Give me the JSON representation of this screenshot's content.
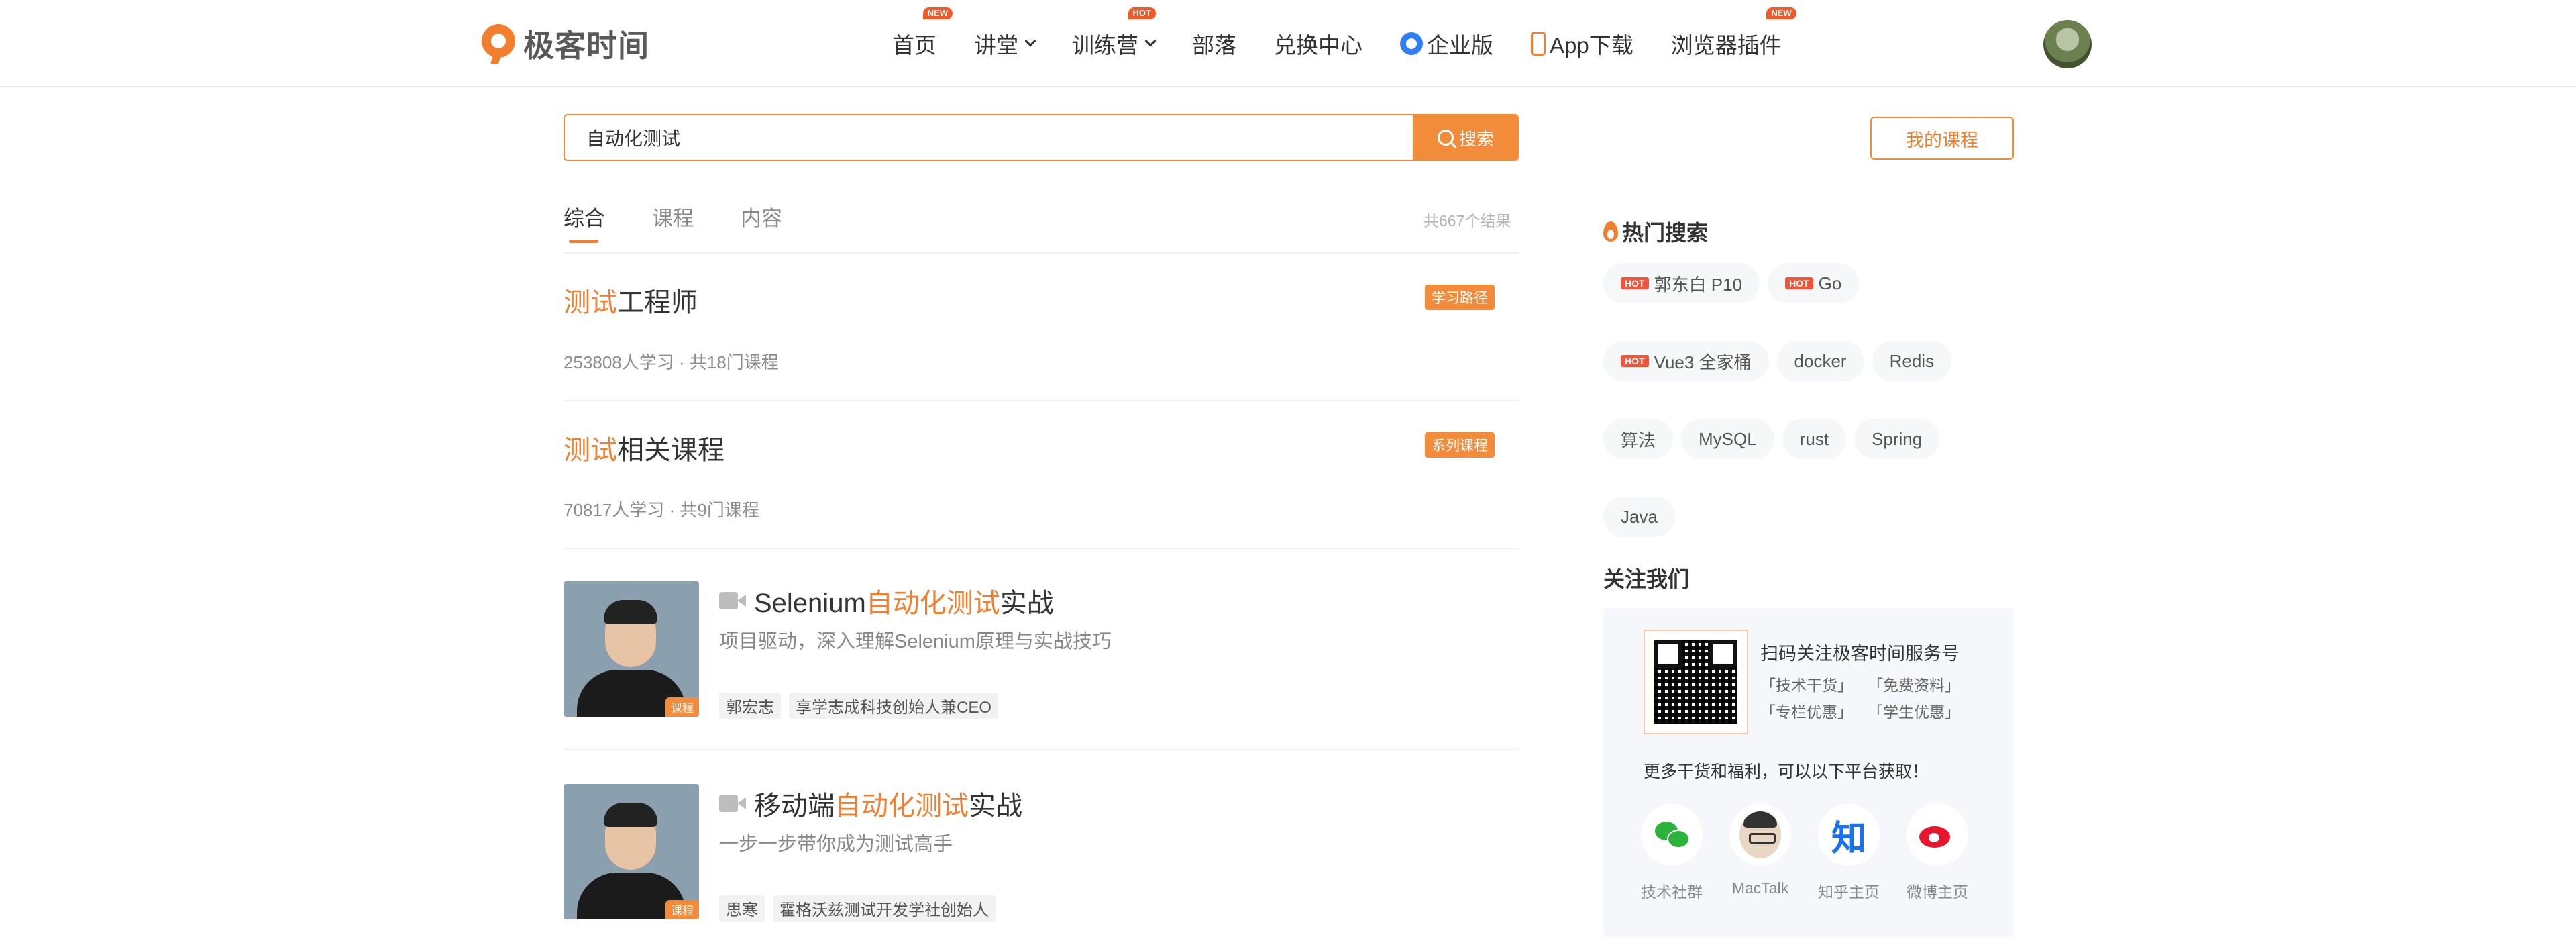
{
  "header": {
    "logo_text": "极客时间",
    "nav": [
      {
        "label": "首页",
        "badge": "NEW",
        "dropdown": false
      },
      {
        "label": "讲堂",
        "badge": "",
        "dropdown": true
      },
      {
        "label": "训练营",
        "badge": "HOT",
        "dropdown": true
      },
      {
        "label": "部落",
        "badge": "",
        "dropdown": false
      },
      {
        "label": "兑换中心",
        "badge": "",
        "dropdown": false
      },
      {
        "label": "企业版",
        "badge": "",
        "dropdown": false,
        "icon": "enterprise-icon"
      },
      {
        "label": "App下载",
        "badge": "",
        "dropdown": false,
        "icon": "phone-icon"
      },
      {
        "label": "浏览器插件",
        "badge": "NEW",
        "dropdown": false
      }
    ]
  },
  "search": {
    "value": "自动化测试",
    "button_label": "搜索",
    "my_courses_label": "我的课程"
  },
  "tabs": {
    "items": [
      "综合",
      "课程",
      "内容"
    ],
    "active": "综合",
    "result_count": "共667个结果"
  },
  "paths": [
    {
      "title_hl": "测试",
      "title_rest": "工程师",
      "meta": "253808人学习 · 共18门课程",
      "tag": "学习路径"
    },
    {
      "title_hl": "测试",
      "title_rest": "相关课程",
      "meta": "70817人学习 · 共9门课程",
      "tag": "系列课程"
    }
  ],
  "courses": [
    {
      "title_pre": "Selenium",
      "title_hl": "自动化测试",
      "title_post": "实战",
      "subtitle": "项目驱动，深入理解Selenium原理与实战技巧",
      "author": "郭宏志",
      "author_title": "享学志成科技创始人兼CEO",
      "thumb_tag": "课程"
    },
    {
      "title_pre": "移动端",
      "title_hl": "自动化测试",
      "title_post": "实战",
      "subtitle": "一步一步带你成为测试高手",
      "author": "思寒",
      "author_title": "霍格沃兹测试开发学社创始人",
      "thumb_tag": "课程"
    }
  ],
  "hot_search": {
    "title": "热门搜索",
    "badge_label": "HOT",
    "tags": [
      {
        "label": "郭东白 P10",
        "hot": true
      },
      {
        "label": "Go",
        "hot": true
      },
      {
        "label": "Vue3 全家桶",
        "hot": true
      },
      {
        "label": "docker",
        "hot": false
      },
      {
        "label": "Redis",
        "hot": false
      },
      {
        "label": "算法",
        "hot": false
      },
      {
        "label": "MySQL",
        "hot": false
      },
      {
        "label": "rust",
        "hot": false
      },
      {
        "label": "Spring",
        "hot": false
      },
      {
        "label": "Java",
        "hot": false
      }
    ]
  },
  "follow": {
    "title": "关注我们",
    "qr_title": "扫码关注极客时间服务号",
    "perks": [
      "「技术干货」",
      "「免费资料」",
      "「专栏优惠」",
      "「学生优惠」"
    ],
    "more_text": "更多干货和福利，可以以下平台获取！",
    "platforms": [
      {
        "label": "技术社群",
        "icon": "wechat-icon"
      },
      {
        "label": "MacTalk",
        "icon": "mactalk-icon"
      },
      {
        "label": "知乎主页",
        "icon": "zhihu-icon",
        "glyph": "知"
      },
      {
        "label": "微博主页",
        "icon": "weibo-icon"
      }
    ]
  },
  "colors": {
    "accent": "#f27f2e",
    "hot": "#f0553a"
  }
}
